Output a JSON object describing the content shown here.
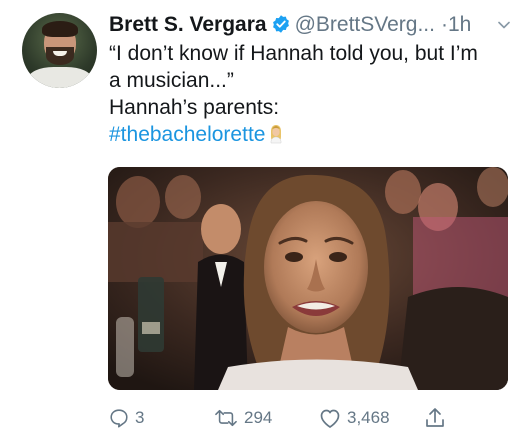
{
  "tweet": {
    "author": {
      "name": "Brett S. Vergara",
      "handle": "@BrettSVerg...",
      "verified": true
    },
    "separator": "·",
    "time": "1h",
    "text_lines": [
      "“I don’t know if Hannah told you, but I’m",
      "a musician...”",
      "Hannah’s parents:"
    ],
    "hashtag": "#thebachelorette",
    "media": {
      "type": "photo"
    },
    "actions": {
      "reply_count": "3",
      "retweet_count": "294",
      "like_count": "3,468"
    }
  },
  "colors": {
    "accent": "#1b95e0",
    "muted": "#657786",
    "text": "#14171a",
    "verified": "#1da1f2"
  }
}
